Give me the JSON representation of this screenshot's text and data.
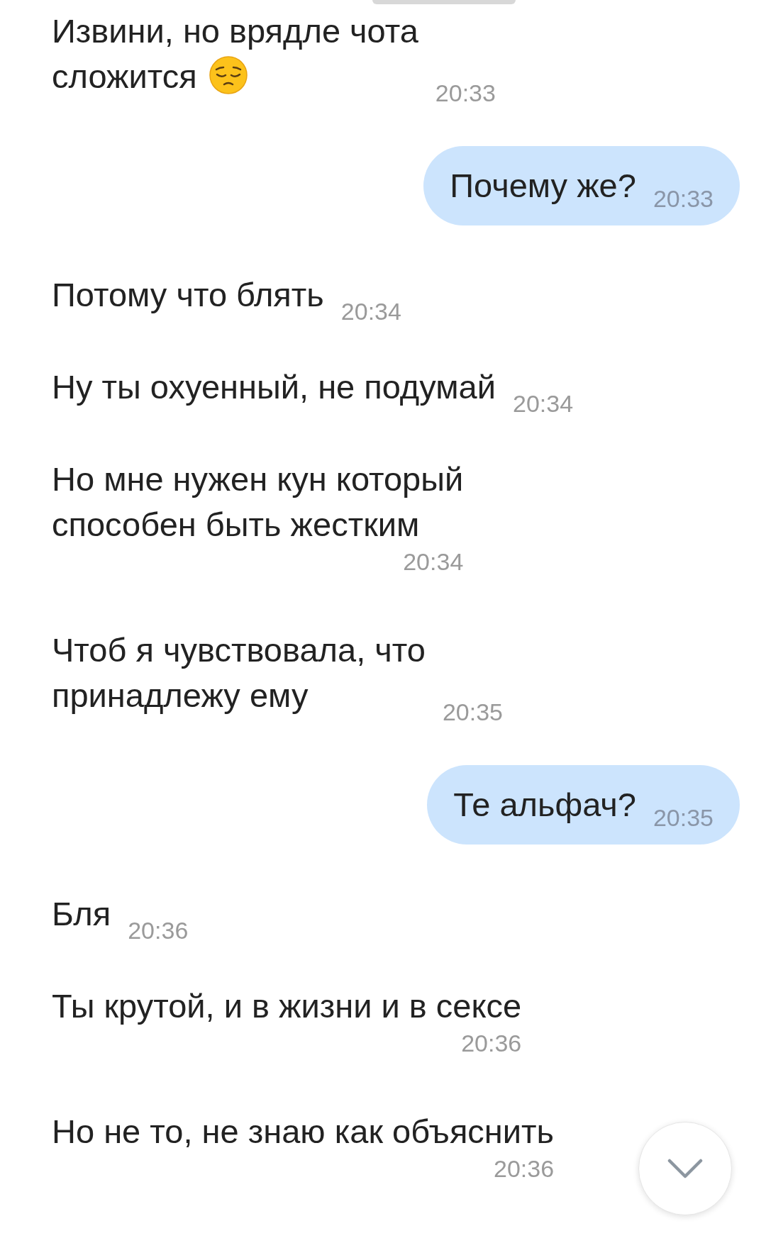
{
  "messages": [
    {
      "kind": "incoming",
      "text": "Извини, но врядле чота\nсложится",
      "emoji": true,
      "time": "20:33"
    },
    {
      "kind": "outgoing",
      "text": "Почему же?",
      "time": "20:33"
    },
    {
      "kind": "incoming",
      "text": "Потому что блять",
      "time": "20:34"
    },
    {
      "kind": "incoming",
      "text": "Ну ты охуенный, не подумай",
      "time": "20:34"
    },
    {
      "kind": "stacked",
      "text": "Но мне нужен кун который\nспособен быть жестким",
      "time": "20:34"
    },
    {
      "kind": "incoming",
      "text": "Чтоб я чувствовала, что\nпринадлежу ему",
      "time": "20:35"
    },
    {
      "kind": "outgoing",
      "text": "Те альфач?",
      "time": "20:35"
    },
    {
      "kind": "incoming",
      "text": "Бля",
      "time": "20:36"
    },
    {
      "kind": "stacked",
      "text": "Ты крутой, и в жизни и в сексе",
      "time": "20:36"
    },
    {
      "kind": "stacked",
      "text": "Но не то, не знаю как объяснить",
      "time": "20:36"
    }
  ]
}
